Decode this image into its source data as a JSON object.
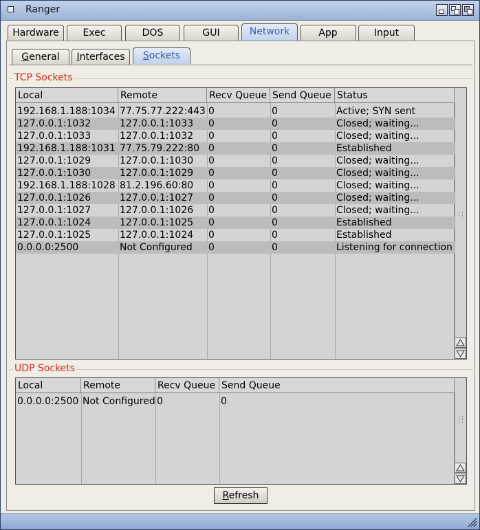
{
  "window": {
    "title": "Ranger"
  },
  "main_tabs": [
    "Hardware",
    "Exec",
    "DOS",
    "GUI",
    "Network",
    "App",
    "Input"
  ],
  "active_main_tab": "Network",
  "sub_tabs": [
    "General",
    "Interfaces",
    "Sockets"
  ],
  "sub_tab_underline": [
    "G",
    "I",
    "S"
  ],
  "active_sub_tab": "Sockets",
  "tcp": {
    "title": "TCP Sockets",
    "columns": [
      "Local",
      "Remote",
      "Recv Queue",
      "Send Queue",
      "Status"
    ],
    "rows": [
      [
        "192.168.1.188:1034",
        "77.75.77.222:443",
        "0",
        "0",
        "Active; SYN sent"
      ],
      [
        "127.0.0.1:1032",
        "127.0.0.1:1033",
        "0",
        "0",
        "Closed; waiting..."
      ],
      [
        "127.0.0.1:1033",
        "127.0.0.1:1032",
        "0",
        "0",
        "Closed; waiting..."
      ],
      [
        "192.168.1.188:1031",
        "77.75.79.222:80",
        "0",
        "0",
        "Established"
      ],
      [
        "127.0.0.1:1029",
        "127.0.0.1:1030",
        "0",
        "0",
        "Closed; waiting..."
      ],
      [
        "127.0.0.1:1030",
        "127.0.0.1:1029",
        "0",
        "0",
        "Closed; waiting..."
      ],
      [
        "192.168.1.188:1028",
        "81.2.196.60:80",
        "0",
        "0",
        "Closed; waiting..."
      ],
      [
        "127.0.0.1:1026",
        "127.0.0.1:1027",
        "0",
        "0",
        "Closed; waiting..."
      ],
      [
        "127.0.0.1:1027",
        "127.0.0.1:1026",
        "0",
        "0",
        "Closed; waiting..."
      ],
      [
        "127.0.0.1:1024",
        "127.0.0.1:1025",
        "0",
        "0",
        "Established"
      ],
      [
        "127.0.0.1:1025",
        "127.0.0.1:1024",
        "0",
        "0",
        "Established"
      ],
      [
        "0.0.0.0:2500",
        "Not Configured",
        "0",
        "0",
        "Listening for connection"
      ]
    ]
  },
  "udp": {
    "title": "UDP Sockets",
    "columns": [
      "Local",
      "Remote",
      "Recv Queue",
      "Send Queue"
    ],
    "rows": [
      [
        "0.0.0.0:2500",
        "Not Configured",
        "0",
        "0"
      ]
    ]
  },
  "refresh_button": {
    "label": "Refresh",
    "underline": "R"
  },
  "colors": {
    "group_title": "#d42a1a",
    "active_tab_text": "#3b5fa8",
    "row_alt": "#bcbcbc"
  },
  "icons": [
    "close-icon",
    "iconify-icon",
    "zoom-icon",
    "depth-icon",
    "resize-grip-icon",
    "scroll-up-icon",
    "scroll-down-icon"
  ]
}
